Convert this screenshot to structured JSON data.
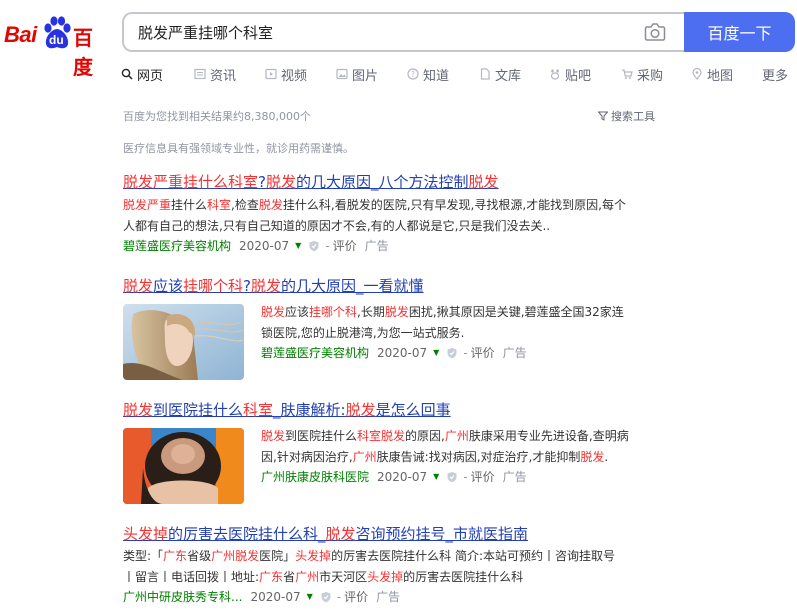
{
  "logo": {
    "bai": "Bai",
    "du": "du",
    "cn": "百度"
  },
  "search": {
    "query": "脱发严重挂哪个科室",
    "button_label": "百度一下"
  },
  "tabs": [
    {
      "label": "网页",
      "icon": "search-icon"
    },
    {
      "label": "资讯",
      "icon": "news-icon"
    },
    {
      "label": "视频",
      "icon": "video-icon"
    },
    {
      "label": "图片",
      "icon": "image-icon"
    },
    {
      "label": "知道",
      "icon": "question-icon"
    },
    {
      "label": "文库",
      "icon": "document-icon"
    },
    {
      "label": "贴吧",
      "icon": "tieba-icon"
    },
    {
      "label": "采购",
      "icon": "cart-icon"
    },
    {
      "label": "地图",
      "icon": "map-pin-icon"
    },
    {
      "label": "更多",
      "icon": ""
    }
  ],
  "meta": {
    "result_count": "百度为您找到相关结果约8,380,000个",
    "tools_label": "搜索工具",
    "notice": "医疗信息具有强领域专业性，就诊用药需谨慎。"
  },
  "results": [
    {
      "title": [
        {
          "t": "脱发严重挂什么科室",
          "hl": true
        },
        {
          "t": "?",
          "hl": false
        },
        {
          "t": "脱发",
          "hl": true
        },
        {
          "t": "的几大原因_八个方法控制",
          "hl": false
        },
        {
          "t": "脱发",
          "hl": true
        }
      ],
      "abstract_line1": [
        {
          "t": "脱发严重",
          "hl": true
        },
        {
          "t": "挂什么",
          "hl": false
        },
        {
          "t": "科室",
          "hl": true
        },
        {
          "t": ",检查",
          "hl": false
        },
        {
          "t": "脱发",
          "hl": true
        },
        {
          "t": "挂什么科,看脱发的医院,只有早发现,寻找根源,才能找到原因,每个",
          "hl": false
        }
      ],
      "abstract_line2": "人都有自己的想法,只有自己知道的原因才不会,有的人都说是它,只是我们没去关..",
      "source": "碧莲盛医疗美容机构",
      "date": "2020-07",
      "eval": "评价",
      "ad": "广告"
    },
    {
      "title": [
        {
          "t": "脱发",
          "hl": true
        },
        {
          "t": "应该",
          "hl": false
        },
        {
          "t": "挂哪个科",
          "hl": true
        },
        {
          "t": "?",
          "hl": false
        },
        {
          "t": "脱发",
          "hl": true
        },
        {
          "t": "的几大原因_一看就懂",
          "hl": false
        }
      ],
      "abstract_line1": [
        {
          "t": "脱发",
          "hl": true
        },
        {
          "t": "应该",
          "hl": false
        },
        {
          "t": "挂哪个科",
          "hl": true
        },
        {
          "t": ",长期",
          "hl": false
        },
        {
          "t": "脱发",
          "hl": true
        },
        {
          "t": "困扰,揪其原因是关键,碧莲盛全国32家连",
          "hl": false
        }
      ],
      "abstract_line2": "锁医院,您的止脱港湾,为您一站式服务.",
      "source": "碧莲盛医疗美容机构",
      "date": "2020-07",
      "eval": "评价",
      "ad": "广告"
    },
    {
      "title": [
        {
          "t": "脱发",
          "hl": true
        },
        {
          "t": "到医院挂什么",
          "hl": false
        },
        {
          "t": "科室",
          "hl": true
        },
        {
          "t": "_肤康解析:",
          "hl": false
        },
        {
          "t": "脱发",
          "hl": true
        },
        {
          "t": "是怎么回事",
          "hl": false
        }
      ],
      "abstract_line1": [
        {
          "t": "脱发",
          "hl": true
        },
        {
          "t": "到医院挂什么",
          "hl": false
        },
        {
          "t": "科室脱发",
          "hl": true
        },
        {
          "t": "的原因,",
          "hl": false
        },
        {
          "t": "广州",
          "hl": true
        },
        {
          "t": "肤康采用专业先进设备,查明病",
          "hl": false
        }
      ],
      "abstract_line2_parts": [
        {
          "t": "因,针对病因治疗,",
          "hl": false
        },
        {
          "t": "广州",
          "hl": true
        },
        {
          "t": "肤康告诫:找对病因,对症治疗,才能抑制",
          "hl": false
        },
        {
          "t": "脱发",
          "hl": true
        },
        {
          "t": ".",
          "hl": false
        }
      ],
      "source": "广州肤康皮肤科医院",
      "date": "2020-07",
      "eval": "评价",
      "ad": "广告"
    },
    {
      "title": [
        {
          "t": "头发掉",
          "hl": true
        },
        {
          "t": "的厉害去医院挂什么科_",
          "hl": false
        },
        {
          "t": "脱发",
          "hl": true
        },
        {
          "t": "咨询预约挂号_市就医指南",
          "hl": false
        }
      ],
      "abstract_line1": [
        {
          "t": "类型:「",
          "hl": false
        },
        {
          "t": "广东",
          "hl": true
        },
        {
          "t": "省级",
          "hl": false
        },
        {
          "t": "广州脱发",
          "hl": true
        },
        {
          "t": "医院」",
          "hl": false
        },
        {
          "t": "头发掉",
          "hl": true
        },
        {
          "t": "的厉害去医院挂什么科 简介:本站可预约丨咨询挂取号",
          "hl": false
        }
      ],
      "abstract_line2_parts": [
        {
          "t": "丨留言丨电话回拨丨地址:",
          "hl": false
        },
        {
          "t": "广东",
          "hl": true
        },
        {
          "t": "省",
          "hl": false
        },
        {
          "t": "广州",
          "hl": true
        },
        {
          "t": "市天河区",
          "hl": false
        },
        {
          "t": "头发掉",
          "hl": true
        },
        {
          "t": "的厉害去医院挂什么科",
          "hl": false
        }
      ],
      "source": "广州中研皮肤秀专科...",
      "date": "2020-07",
      "eval": "评价",
      "ad": "广告"
    }
  ],
  "colors": {
    "brand_red": "#e10602",
    "accent_blue": "#4e6ef2",
    "link": "#2440b3",
    "highlight": "#f73131",
    "source_green": "#008000"
  }
}
